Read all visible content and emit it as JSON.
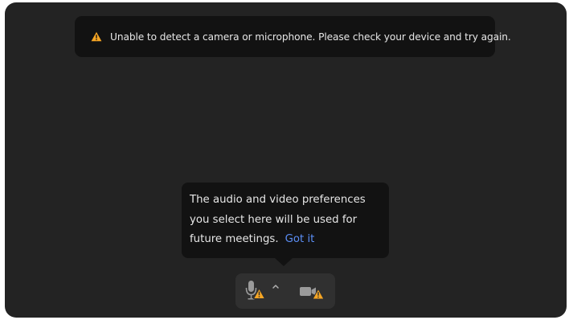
{
  "banner": {
    "message": "Unable to detect a camera or microphone. Please check your device and try again.",
    "icon": "warning-icon",
    "warning_color": "#f5a524"
  },
  "tooltip": {
    "text": "The audio and video preferences you select here will be used for future meetings.",
    "action_label": "Got it",
    "action_color": "#5b8ef5"
  },
  "controls": {
    "mic_icon": "microphone-icon",
    "mic_status_icon": "warning-icon",
    "options_icon": "chevron-up-icon",
    "camera_icon": "video-camera-icon",
    "camera_status_icon": "warning-icon"
  }
}
